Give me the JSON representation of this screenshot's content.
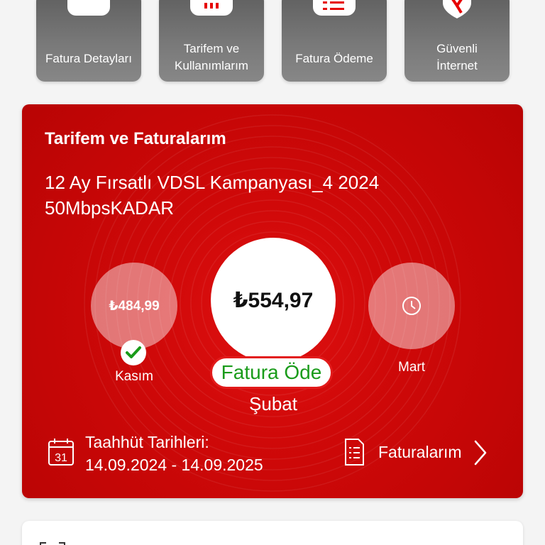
{
  "quick_actions": [
    {
      "label": "Fatura Detayları",
      "icon": "invoice-details-icon"
    },
    {
      "label": "Tarifem ve\nKullanımlarım",
      "icon": "usage-icon"
    },
    {
      "label": "Fatura Ödeme",
      "icon": "bill-payment-icon"
    },
    {
      "label": "Güvenli\nİnternet",
      "icon": "shield-icon"
    }
  ],
  "card": {
    "title": "Tarifem ve Faturalarım",
    "plan_name": "12 Ay Fırsatlı VDSL Kampanyası_4 2024 50MbpsKADAR",
    "bills": {
      "past": {
        "amount": "₺484,99",
        "month": "Kasım",
        "status": "paid"
      },
      "current": {
        "amount": "₺554,97",
        "month": "Şubat",
        "action": "Fatura Öde"
      },
      "future": {
        "month": "Mart",
        "status": "pending"
      }
    },
    "commitment": {
      "label": "Taahhüt Tarihleri:",
      "dates": "14.09.2024 - 14.09.2025",
      "calendar_day": "31"
    },
    "bills_link": "Faturalarım"
  },
  "colors": {
    "brand_red": "#d40a0a",
    "pay_green": "#1a9b1a",
    "tile_gray": "#707070"
  }
}
